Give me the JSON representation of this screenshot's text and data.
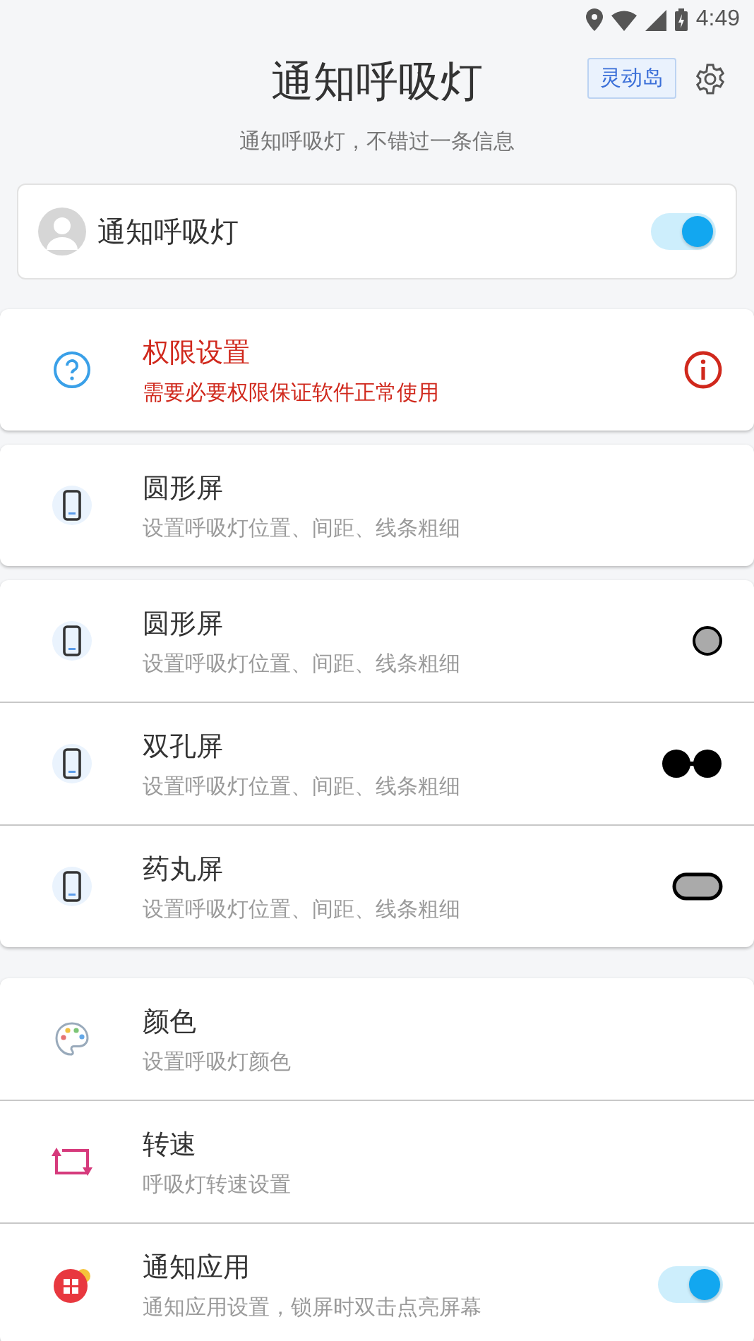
{
  "status_bar": {
    "time": "4:49"
  },
  "header": {
    "title": "通知呼吸灯",
    "badge": "灵动岛",
    "subtitle": "通知呼吸灯，不错过一条信息"
  },
  "master": {
    "label": "通知呼吸灯",
    "on": true
  },
  "groups": [
    {
      "rows": [
        {
          "kind": "permission",
          "title": "权限设置",
          "subtitle": "需要必要权限保证软件正常使用",
          "warning": true
        }
      ]
    },
    {
      "rows": [
        {
          "kind": "screen",
          "title": "圆形屏",
          "subtitle": "设置呼吸灯位置、间距、线条粗细",
          "warning": false
        }
      ]
    },
    {
      "rows": [
        {
          "kind": "round",
          "title": "圆形屏",
          "subtitle": "设置呼吸灯位置、间距、线条粗细",
          "warning": false
        },
        {
          "kind": "dual",
          "title": "双孔屏",
          "subtitle": "设置呼吸灯位置、间距、线条粗细",
          "warning": false
        },
        {
          "kind": "pill",
          "title": "药丸屏",
          "subtitle": "设置呼吸灯位置、间距、线条粗细",
          "warning": false
        }
      ]
    },
    {
      "rows": [
        {
          "kind": "palette",
          "title": "颜色",
          "subtitle": "设置呼吸灯颜色",
          "warning": false
        },
        {
          "kind": "speed",
          "title": "转速",
          "subtitle": "呼吸灯转速设置",
          "warning": false
        },
        {
          "kind": "apps",
          "title": "通知应用",
          "subtitle": "通知应用设置，锁屏时双击点亮屏幕",
          "warning": false,
          "on": true
        }
      ]
    }
  ]
}
